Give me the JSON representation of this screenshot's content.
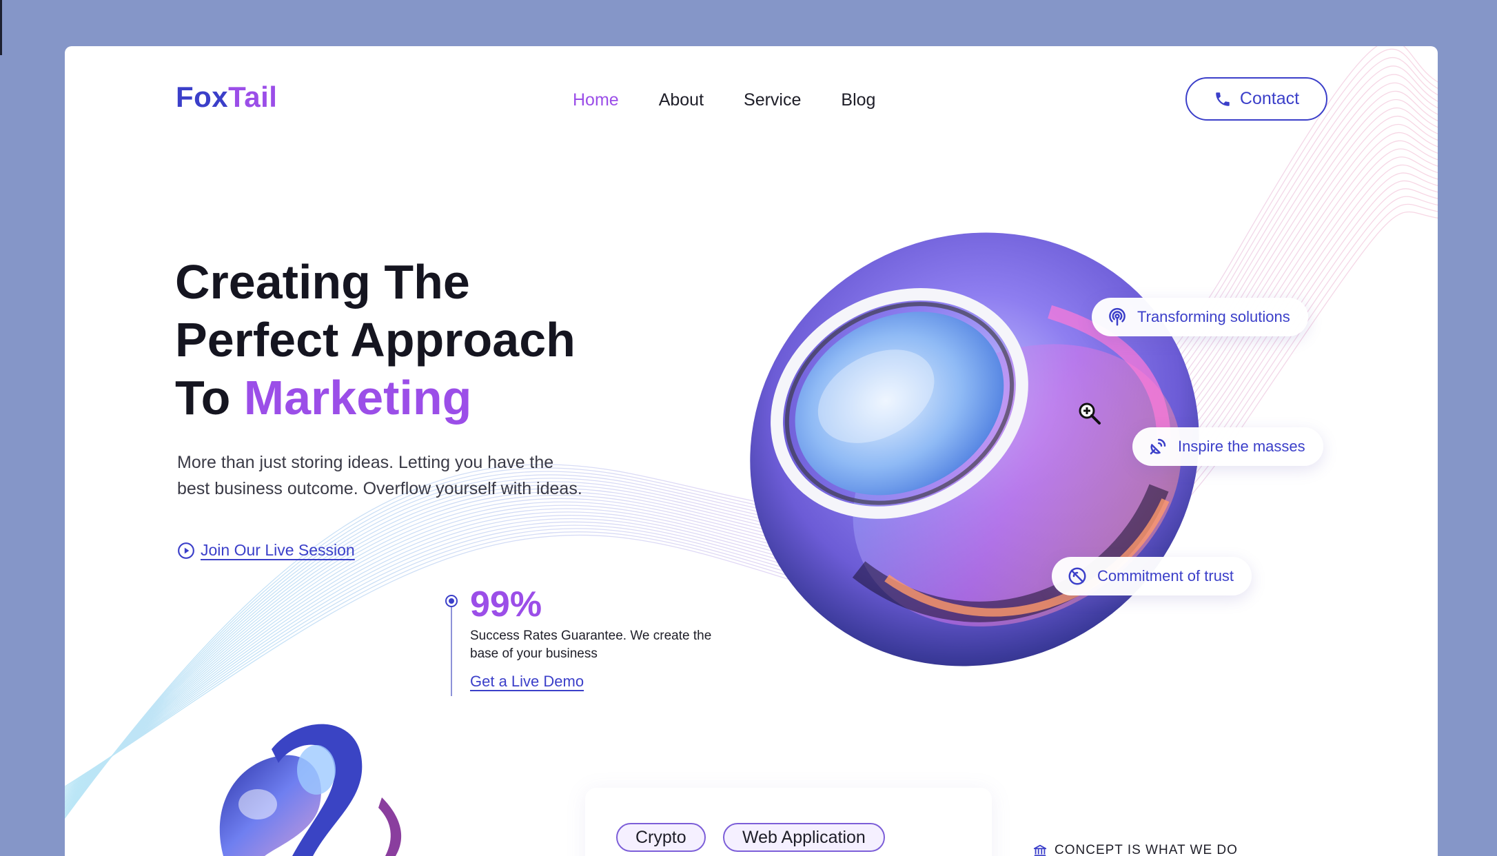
{
  "brand": {
    "logo_part1": "Fox",
    "logo_part2": "Tail"
  },
  "nav": {
    "items": [
      {
        "label": "Home",
        "active": true
      },
      {
        "label": "About"
      },
      {
        "label": "Service"
      },
      {
        "label": "Blog"
      }
    ]
  },
  "contact": {
    "label": "Contact",
    "icon": "phone-icon"
  },
  "hero": {
    "title_line1": "Creating The",
    "title_line2": "Perfect Approach",
    "title_line3_prefix": "To",
    "title_line3_accent": "Marketing",
    "description": "More than just storing ideas. Letting you have the best business outcome. Overflow yourself with ideas.",
    "live_link": "Join Our Live Session"
  },
  "stat": {
    "value": "99%",
    "description": "Success Rates Guarantee. We create the base of your business",
    "link": "Get a Live Demo"
  },
  "features": [
    {
      "label": "Transforming solutions",
      "icon": "broadcast-icon"
    },
    {
      "label": "Inspire the masses",
      "icon": "satellite-dish-icon"
    },
    {
      "label": "Commitment of trust",
      "icon": "no-sign-icon"
    }
  ],
  "tags": [
    "Crypto",
    "Web Application"
  ],
  "concept": {
    "label": "CONCEPT IS WHAT WE DO",
    "icon": "bank-icon"
  },
  "colors": {
    "primary": "#3b3fc9",
    "accent": "#9b4ee8",
    "backdrop": "#8596c8"
  }
}
